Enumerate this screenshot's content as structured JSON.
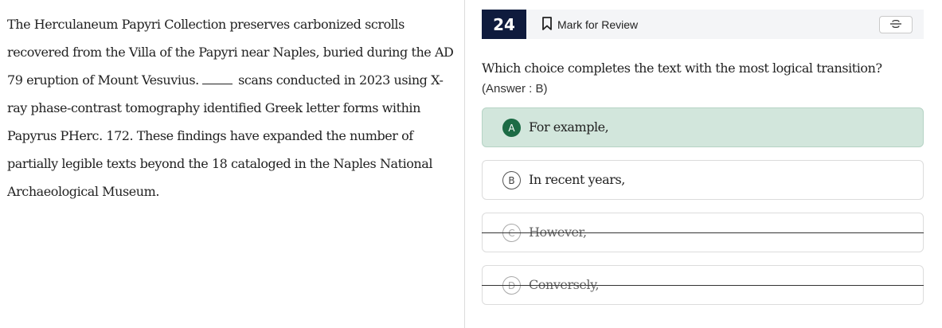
{
  "passage": {
    "before_blank": "The Herculaneum Papyri Collection preserves carbonized scrolls recovered from the Villa of the Papyri near Naples, buried during the AD 79 eruption of Mount Vesuvius.",
    "after_blank": "scans conducted in 2023 using X-ray phase-contrast tomography identified Greek letter forms within Papyrus PHerc. 172. These findings have expanded the number of partially legible texts beyond the 18 cataloged in the Naples National Archaeological Museum."
  },
  "question": {
    "number": "24",
    "mark_for_review_label": "Mark for Review",
    "prompt": "Which choice completes the text with the most logical transition?",
    "answer_note": "(Answer : B)"
  },
  "choices": [
    {
      "letter": "A",
      "text": "For example,"
    },
    {
      "letter": "B",
      "text": "In recent years,"
    },
    {
      "letter": "C",
      "text": "However,"
    },
    {
      "letter": "D",
      "text": "Conversely,"
    }
  ],
  "icons": {
    "bookmark": "bookmark-icon",
    "strikethrough_tool": "strikethrough-icon"
  },
  "colors": {
    "question_number_bg": "#0f1b3d",
    "selected_choice_bg": "#d2e6dc",
    "selected_letter_bg": "#1c6b45"
  }
}
